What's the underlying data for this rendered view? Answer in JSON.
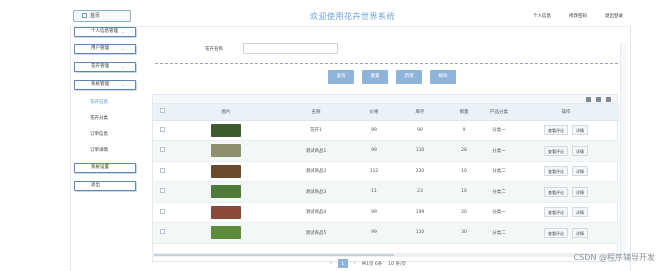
{
  "header": {
    "crumb": "首页",
    "title": "欢迎使用花卉世界系统",
    "links": [
      "个人信息",
      "修改密码",
      "退出登录"
    ]
  },
  "sidebar": {
    "menus": [
      "个人信息管理",
      "用户管理",
      "花卉管理",
      "系统管理"
    ],
    "sub_items": [
      "花卉信息",
      "花卉分类",
      "订单信息",
      "订单详情"
    ],
    "active_sub": "花卉信息",
    "bottom_menus": [
      "系统设置",
      "退出"
    ]
  },
  "search": {
    "label": "花卉名称",
    "value": ""
  },
  "buttons": [
    "查询",
    "重置",
    "新增",
    "删除"
  ],
  "table": {
    "headers": [
      "",
      "图片",
      "名称",
      "价格",
      "库存",
      "销量",
      "产品分类",
      "操作"
    ],
    "rows": [
      {
        "name": "花卉1",
        "price": "99",
        "stock": "99",
        "sales": "9",
        "category": "分类一",
        "img": "#3d5b2f"
      },
      {
        "name": "测试商品1",
        "price": "99",
        "stock": "110",
        "sales": "28",
        "category": "分类一",
        "img": "#8c8f6d"
      },
      {
        "name": "测试商品2",
        "price": "112",
        "stock": "220",
        "sales": "10",
        "category": "分类二",
        "img": "#6b4a2e"
      },
      {
        "name": "测试商品3",
        "price": "11",
        "stock": "23",
        "sales": "10",
        "category": "分类二",
        "img": "#4f7a3a"
      },
      {
        "name": "测试商品4",
        "price": "99",
        "stock": "199",
        "sales": "20",
        "category": "分类一",
        "img": "#8a4a3a"
      },
      {
        "name": "测试商品5",
        "price": "99",
        "stock": "110",
        "sales": "30",
        "category": "分类二",
        "img": "#5e8a3c"
      }
    ],
    "actions": {
      "view": "查看评论",
      "detail": "详情"
    }
  },
  "pager": {
    "prev": "‹",
    "current": "1",
    "next": "›",
    "total_text": "共1页 6条",
    "size_text": "10 条/页"
  },
  "watermark": "CSDN @程序辅导开发"
}
